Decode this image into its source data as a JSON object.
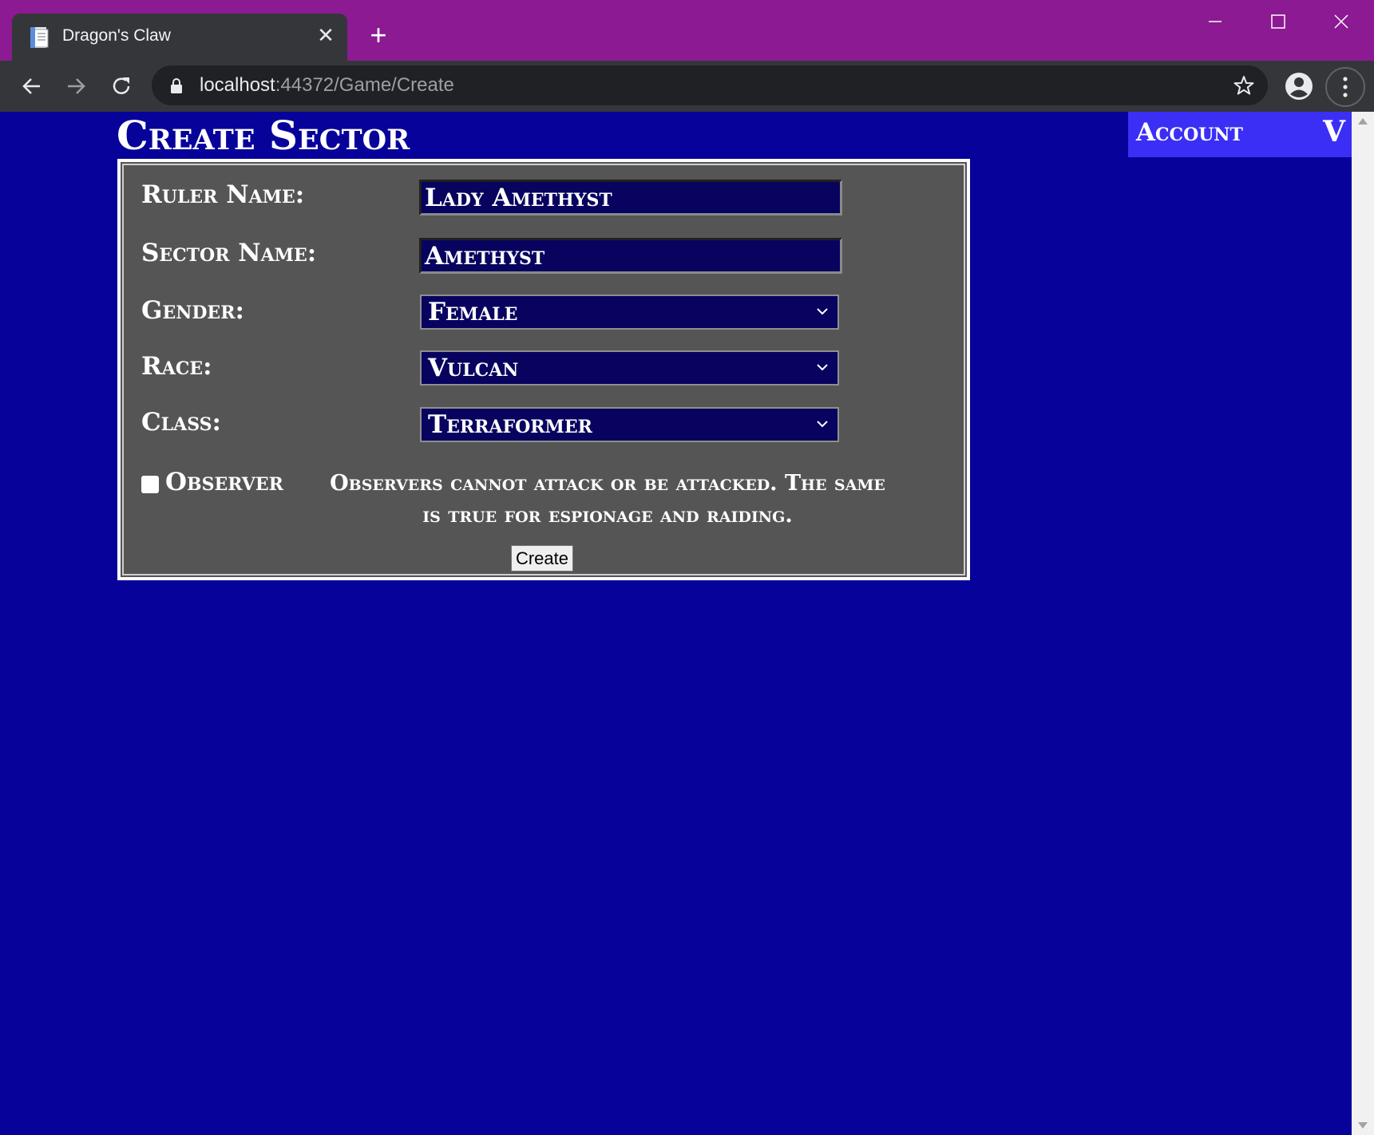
{
  "browser": {
    "tab_title": "Dragon's Claw",
    "tab_close": "✕",
    "new_tab": "+",
    "url_host": "localhost",
    "url_path": ":44372/Game/Create"
  },
  "header": {
    "title": "Create Sector",
    "account_label": "Account",
    "account_toggle": "V"
  },
  "form": {
    "ruler_name_label": "Ruler Name:",
    "ruler_name_value": "Lady Amethyst",
    "sector_name_label": "Sector Name:",
    "sector_name_value": "Amethyst",
    "gender_label": "Gender:",
    "gender_value": "Female",
    "race_label": "Race:",
    "race_value": "Vulcan",
    "class_label": "Class:",
    "class_value": "Terraformer",
    "observer_label": "Observer",
    "observer_checked": false,
    "observer_note": "Observers cannot attack or be attacked. The same is true for espionage and raiding.",
    "create_button": "Create"
  },
  "colors": {
    "page_background": "#07039a",
    "panel_background": "#555555",
    "field_background": "#07035f",
    "account_background": "#3b2ff5",
    "titlebar": "#8c1a92"
  }
}
